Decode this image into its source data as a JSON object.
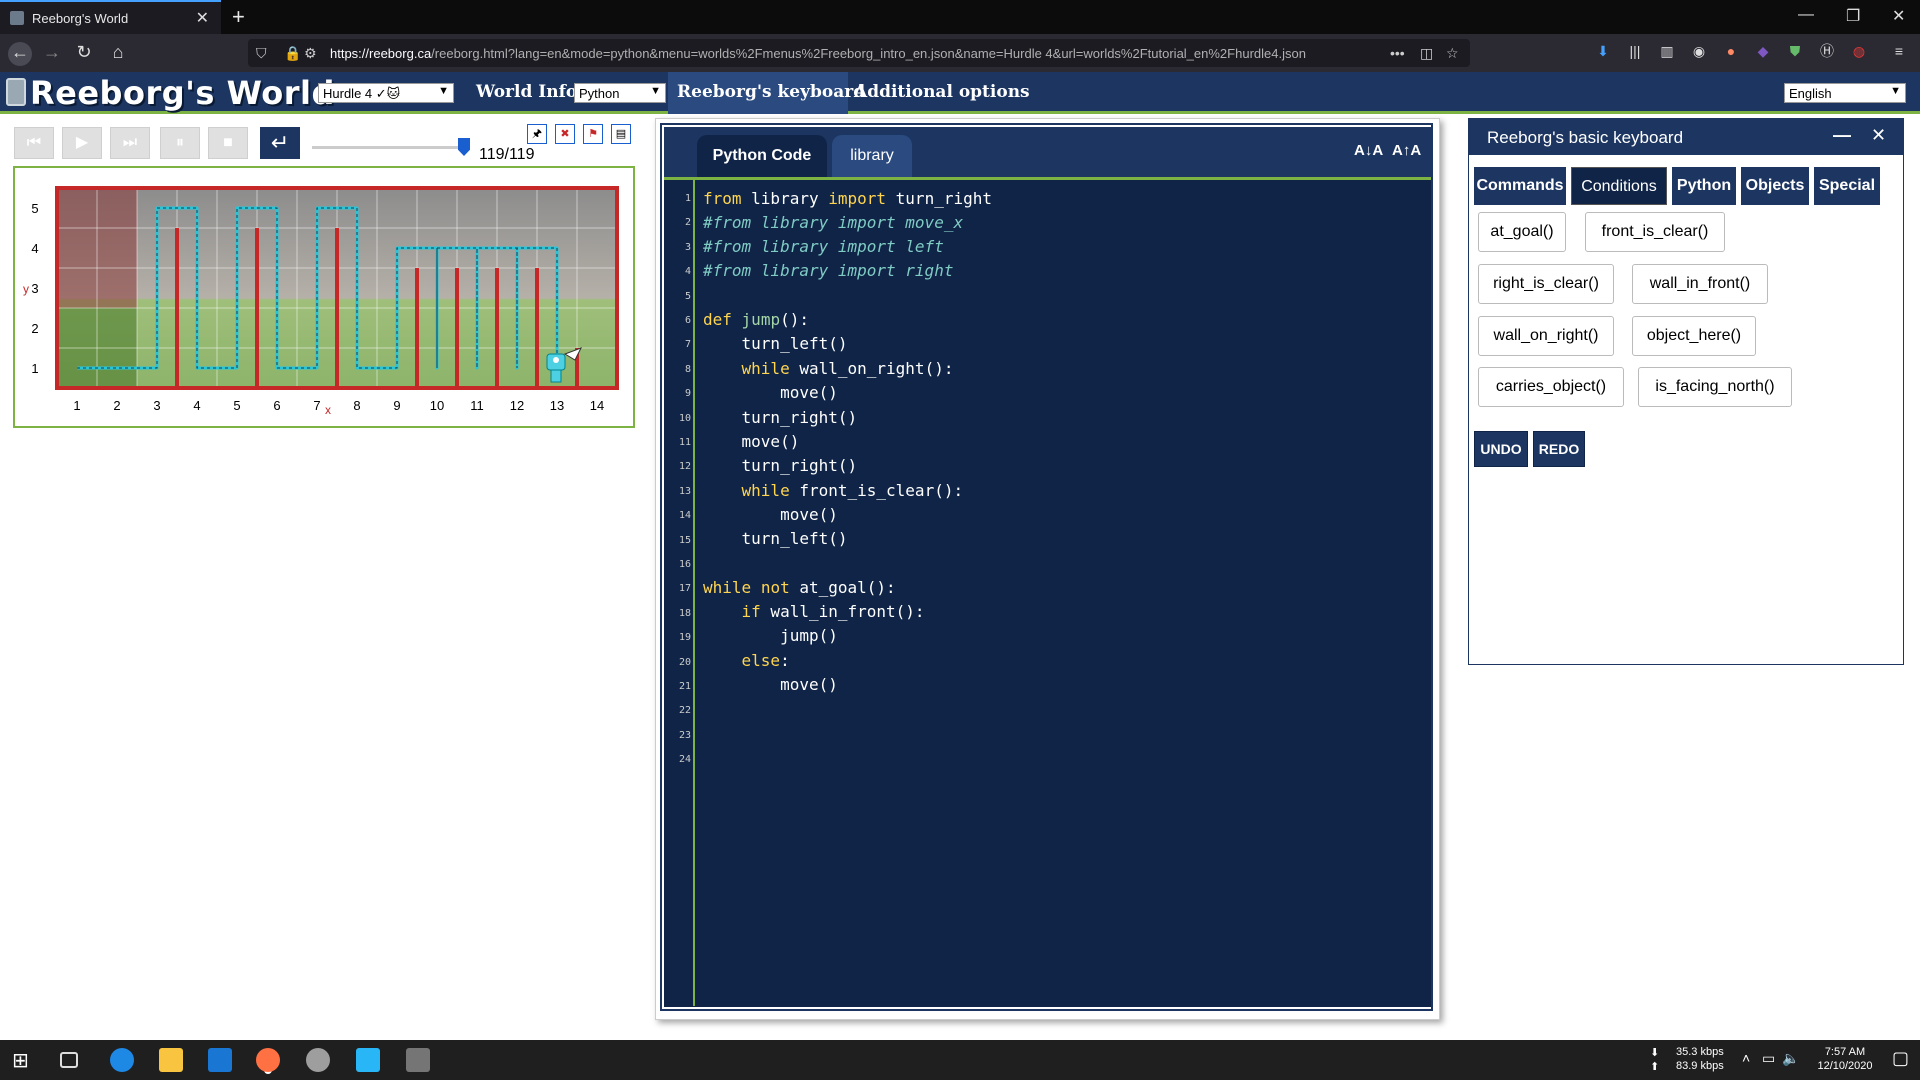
{
  "browser": {
    "tab_title": "Reeborg's World",
    "url_host": "https://reeborg.ca",
    "url_path": "/reeborg.html?lang=en&mode=python&menu=worlds%2Fmenus%2Freeborg_intro_en.json&name=Hurdle 4&url=worlds%2Ftutorial_en%2Fhurdle4.json"
  },
  "header": {
    "title": "Reeborg's World",
    "world_select": "Hurdle 4 ✓🐱",
    "world_info": "World Info",
    "mode_select": "Python",
    "keyboard": "Reeborg's keyboard",
    "additional_options": "Additional options",
    "language_select": "English"
  },
  "controls": {
    "step_counter": "119/119",
    "progress": 1.0
  },
  "world": {
    "y_label": "y",
    "x_label": "x",
    "x_ticks": [
      "1",
      "2",
      "3",
      "4",
      "5",
      "6",
      "7",
      "8",
      "9",
      "10",
      "11",
      "12",
      "13",
      "14"
    ],
    "y_ticks": [
      "1",
      "2",
      "3",
      "4",
      "5"
    ]
  },
  "editor": {
    "tab_python": "Python Code",
    "tab_library": "library",
    "font_smaller": "A↓A",
    "font_larger": "A↑A",
    "line_numbers": [
      "1",
      "2",
      "3",
      "4",
      "5",
      "6",
      "7",
      "8",
      "9",
      "10",
      "11",
      "12",
      "13",
      "14",
      "15",
      "16",
      "17",
      "18",
      "19",
      "20",
      "21",
      "22",
      "23",
      "24"
    ]
  },
  "keyboard": {
    "title": "Reeborg's basic keyboard",
    "tabs": [
      "Commands",
      "Conditions",
      "Python",
      "Objects",
      "Special"
    ],
    "keys": [
      "at_goal()",
      "front_is_clear()",
      "right_is_clear()",
      "wall_in_front()",
      "wall_on_right()",
      "object_here()",
      "carries_object()",
      "is_facing_north()"
    ],
    "undo": "UNDO",
    "redo": "REDO"
  },
  "taskbar": {
    "net_down": "35.3 kbps",
    "net_up": "83.9 kbps",
    "time": "7:57 AM",
    "date": "12/10/2020"
  },
  "colors": {
    "accent": "#1c3561",
    "green": "#7cb342",
    "wall_red": "#c62828",
    "path_cyan": "#26c6da"
  }
}
